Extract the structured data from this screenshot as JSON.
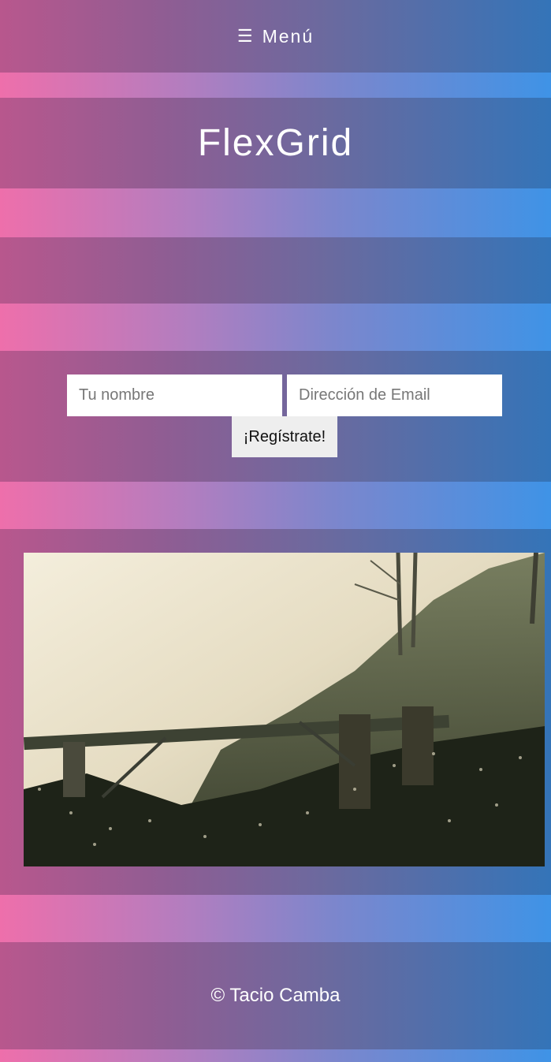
{
  "nav": {
    "menu_icon": "hamburger-icon",
    "menu_label": "Menú"
  },
  "header": {
    "title": "FlexGrid"
  },
  "signup": {
    "name_placeholder": "Tu nombre",
    "email_placeholder": "Dirección de Email",
    "submit_label": "¡Regístrate!"
  },
  "footer": {
    "copyright": "© Tacio Camba"
  },
  "colors": {
    "stripe_left": "#ee6fab",
    "stripe_right": "#3f93e6",
    "band_left": "#b8578d",
    "band_right": "#3474b8"
  }
}
